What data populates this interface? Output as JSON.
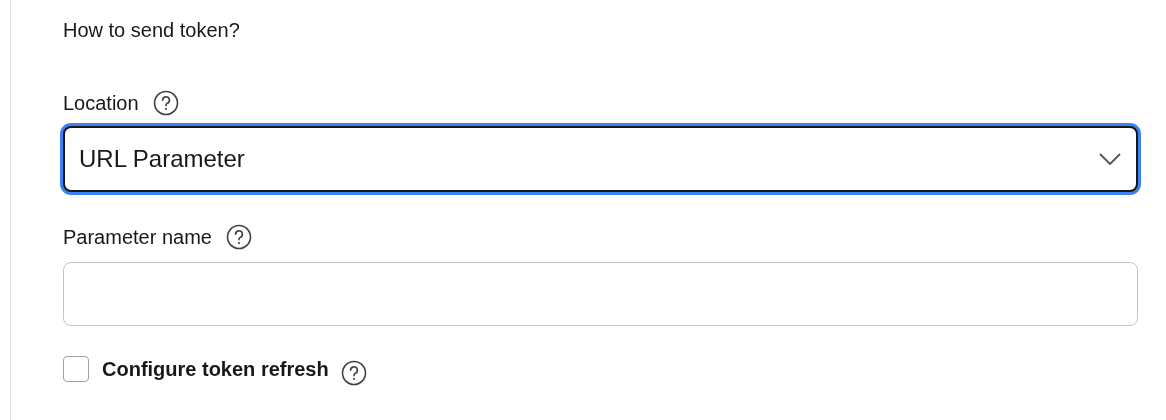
{
  "heading": "How to send token?",
  "location": {
    "label": "Location",
    "value": "URL Parameter",
    "focused": true
  },
  "parameter_name": {
    "label": "Parameter name",
    "focused": false
  },
  "token_refresh": {
    "label": "Configure token refresh",
    "checked": false
  }
}
